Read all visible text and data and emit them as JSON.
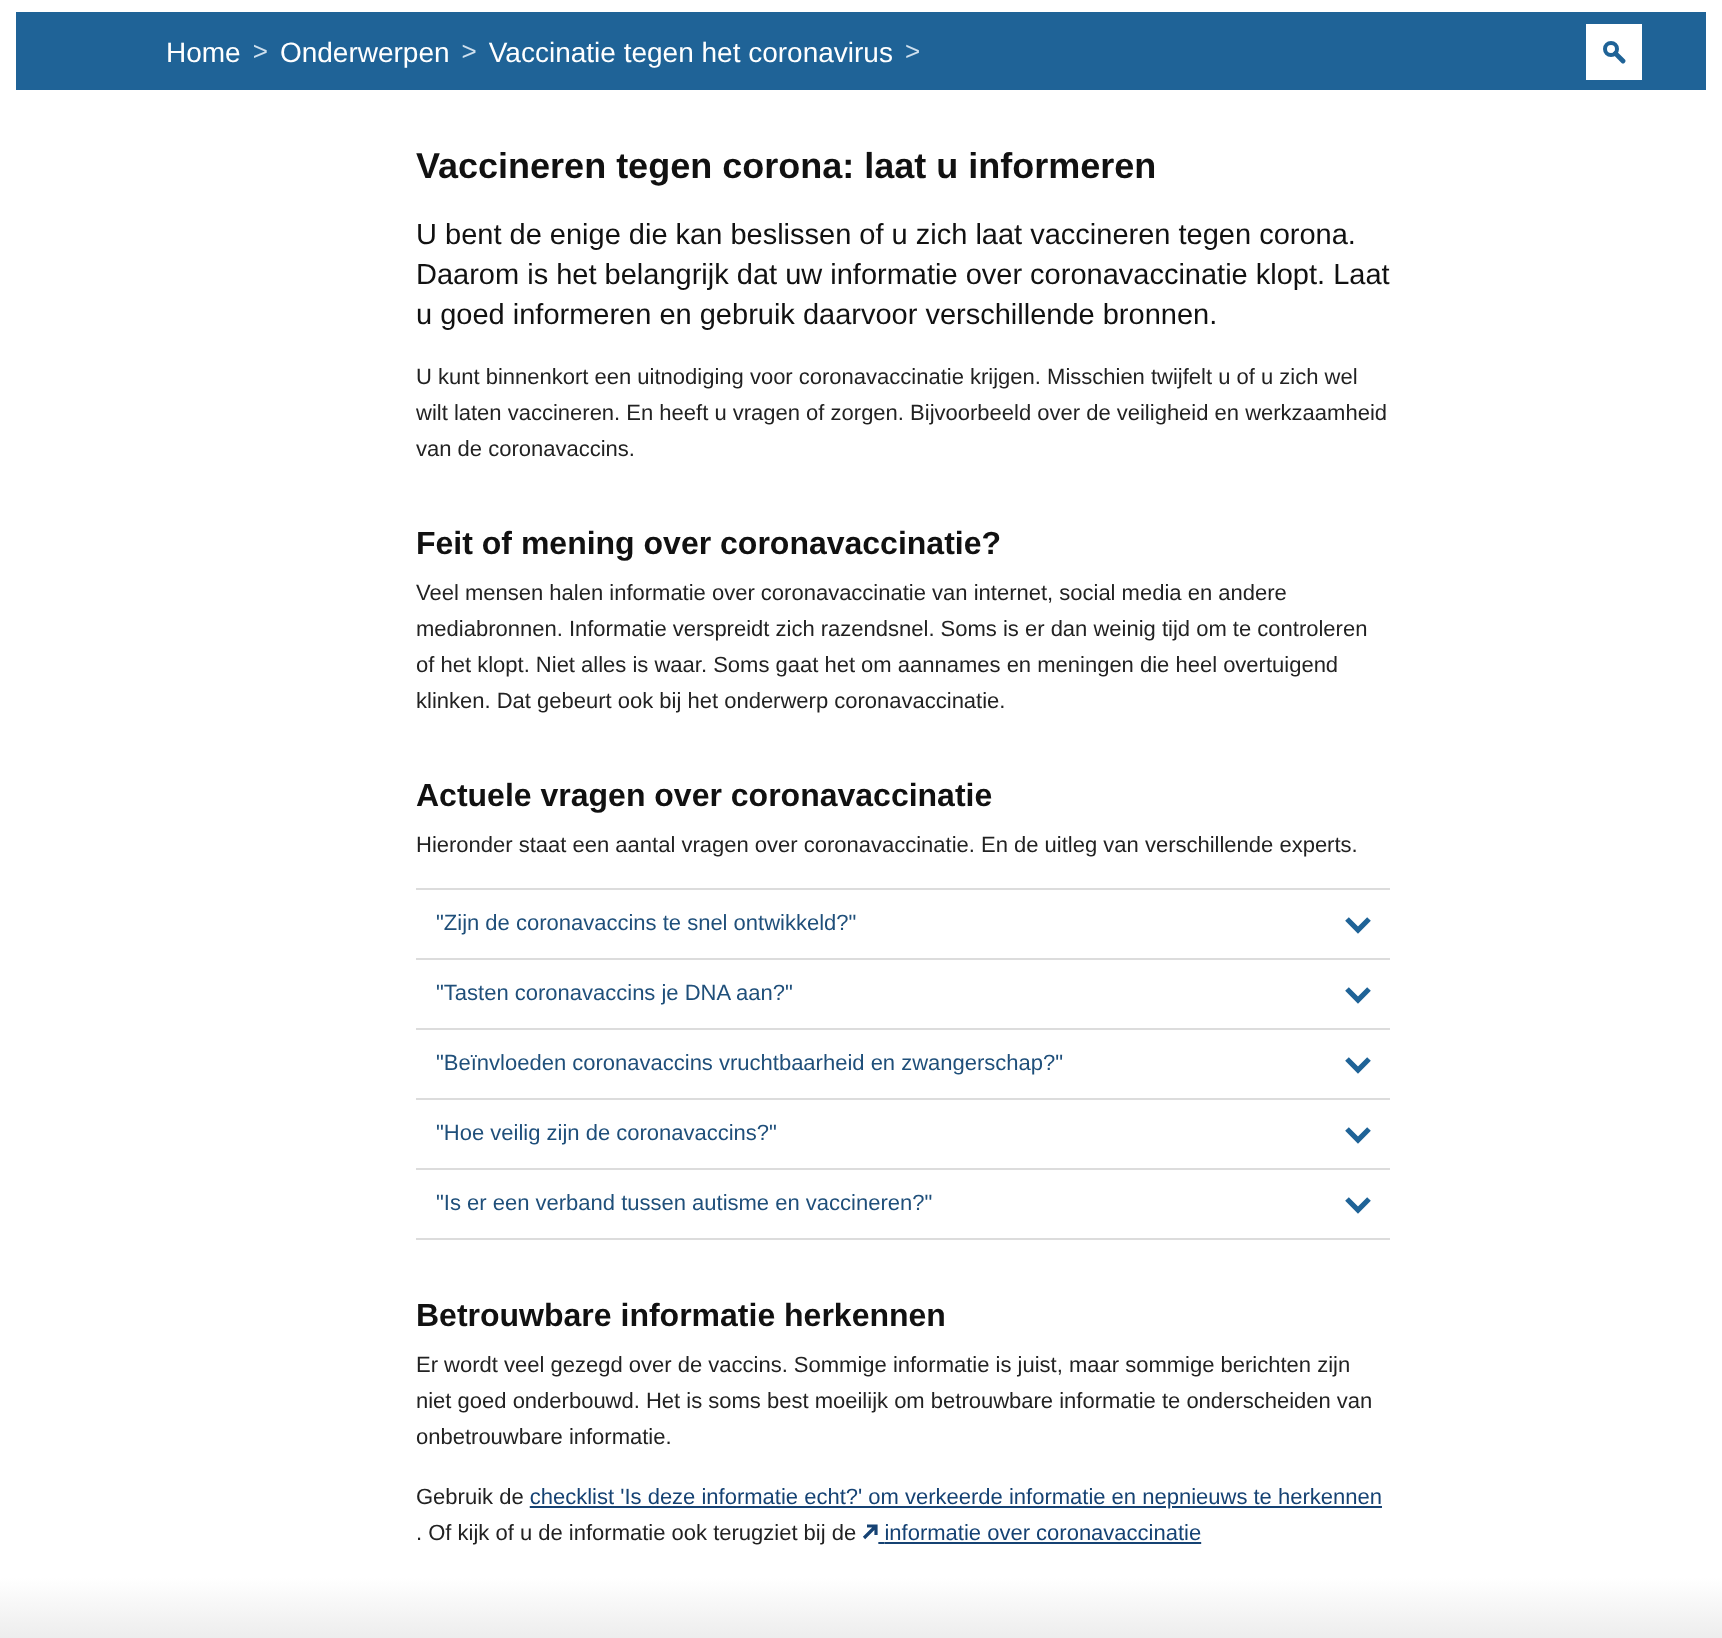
{
  "breadcrumb": [
    {
      "label": "Home"
    },
    {
      "label": "Onderwerpen"
    },
    {
      "label": "Vaccinatie tegen het coronavirus"
    }
  ],
  "breadcrumb_separator": ">",
  "title": "Vaccineren tegen corona: laat u informeren",
  "lead": "U bent de enige die kan beslissen of u zich laat vaccineren tegen corona. Daarom is het belangrijk dat uw informatie over coronavaccinatie klopt. Laat u goed informeren en gebruik daarvoor verschillende bronnen.",
  "intro": "U kunt binnenkort een uitnodiging voor coronavaccinatie krijgen. Misschien twijfelt u of u zich wel wilt laten vaccineren. En heeft u vragen of zorgen. Bijvoorbeeld over de veiligheid en werkzaamheid van de coronavaccins.",
  "sections": [
    {
      "heading": "Feit of mening over coronavaccinatie?",
      "paragraphs": [
        [
          {
            "kind": "text",
            "text": "Veel mensen halen informatie over coronavaccinatie van internet, social media en andere mediabronnen. Informatie verspreidt zich razendsnel. Soms is er dan weinig tijd om te controleren of het klopt. Niet alles is waar. Soms gaat het om aannames en meningen die heel overtuigend  klinken. Dat gebeurt ook bij het onderwerp coronavaccinatie."
          }
        ]
      ]
    },
    {
      "heading": "Actuele vragen over coronavaccinatie",
      "paragraphs": [
        [
          {
            "kind": "text",
            "text": "Hieronder staat een aantal vragen over coronavaccinatie. En de uitleg van verschillende experts."
          }
        ]
      ],
      "accordion": [
        {
          "question": "\"Zijn de coronavaccins te snel ontwikkeld?\"",
          "expanded": false
        },
        {
          "question": "\"Tasten coronavaccins je DNA aan?\"",
          "expanded": false
        },
        {
          "question": "\"Beïnvloeden coronavaccins vruchtbaarheid en zwangerschap?\"",
          "expanded": false
        },
        {
          "question": "\"Hoe veilig zijn de coronavaccins?\"",
          "expanded": false
        },
        {
          "question": "\"Is er een verband tussen autisme en vaccineren?\"",
          "expanded": false
        }
      ]
    },
    {
      "heading": "Betrouwbare informatie herkennen",
      "paragraphs": [
        [
          {
            "kind": "text",
            "text": "Er wordt veel gezegd over de vaccins. Sommige informatie is juist, maar sommige berichten zijn niet goed onderbouwd. Het is soms best moeilijk om betrouwbare informatie te onderscheiden van onbetrouwbare informatie."
          }
        ],
        [
          {
            "kind": "text",
            "text": "Gebruik de"
          },
          {
            "kind": "link",
            "text": "checklist 'Is deze informatie echt?' om verkeerde informatie en nepnieuws te herkennen"
          },
          {
            "kind": "text",
            "text": ". Of kijk of u de informatie ook terugziet bij de"
          },
          {
            "kind": "external_link",
            "text": "informatie over coronavaccinatie"
          }
        ]
      ]
    }
  ]
}
